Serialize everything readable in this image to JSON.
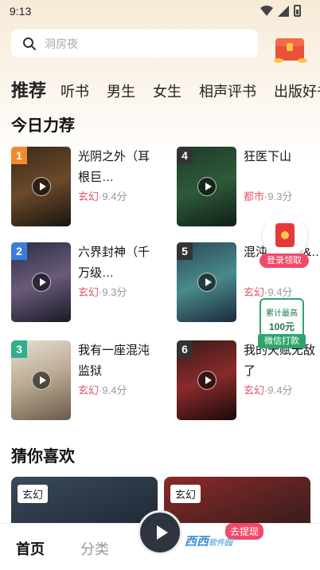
{
  "status": {
    "time": "9:13"
  },
  "search": {
    "placeholder": "洞房夜"
  },
  "categories": [
    "推荐",
    "听书",
    "男生",
    "女生",
    "相声评书",
    "出版好书"
  ],
  "sections": {
    "today": "今日力荐",
    "guess": "猜你喜欢"
  },
  "books": [
    {
      "rank": "1",
      "title": "光阴之外（耳根巨…",
      "genre": "玄幻",
      "score": "9.4分",
      "rank_color": "#f08a2a"
    },
    {
      "rank": "4",
      "title": "狂医下山",
      "genre": "都市",
      "score": "9.3分",
      "rank_color": "#333333"
    },
    {
      "rank": "2",
      "title": "六界封神（千万级…",
      "genre": "玄幻",
      "score": "9.3分",
      "rank_color": "#3b7ce0"
    },
    {
      "rank": "5",
      "title": "混沌（霸王&…",
      "genre": "玄幻",
      "score": "9.4分",
      "rank_color": "#333333"
    },
    {
      "rank": "3",
      "title": "我有一座混沌监狱",
      "genre": "玄幻",
      "score": "9.4分",
      "rank_color": "#2fb08a"
    },
    {
      "rank": "6",
      "title": "我的天赋无敌了",
      "genre": "玄幻",
      "score": "9.4分",
      "rank_color": "#333333"
    }
  ],
  "score_sep": "·",
  "widgets": {
    "redpacket_label": "登录领取",
    "promo_line1": "累计最高",
    "promo_line2": "100元",
    "promo_btn": "微信打款",
    "withdraw": "去提现"
  },
  "recommend": [
    {
      "tag": "玄幻"
    },
    {
      "tag": "玄幻"
    }
  ],
  "nav": {
    "home": "首页",
    "category": "分类"
  },
  "watermark": {
    "text": "西西",
    "sub": "软件园"
  }
}
